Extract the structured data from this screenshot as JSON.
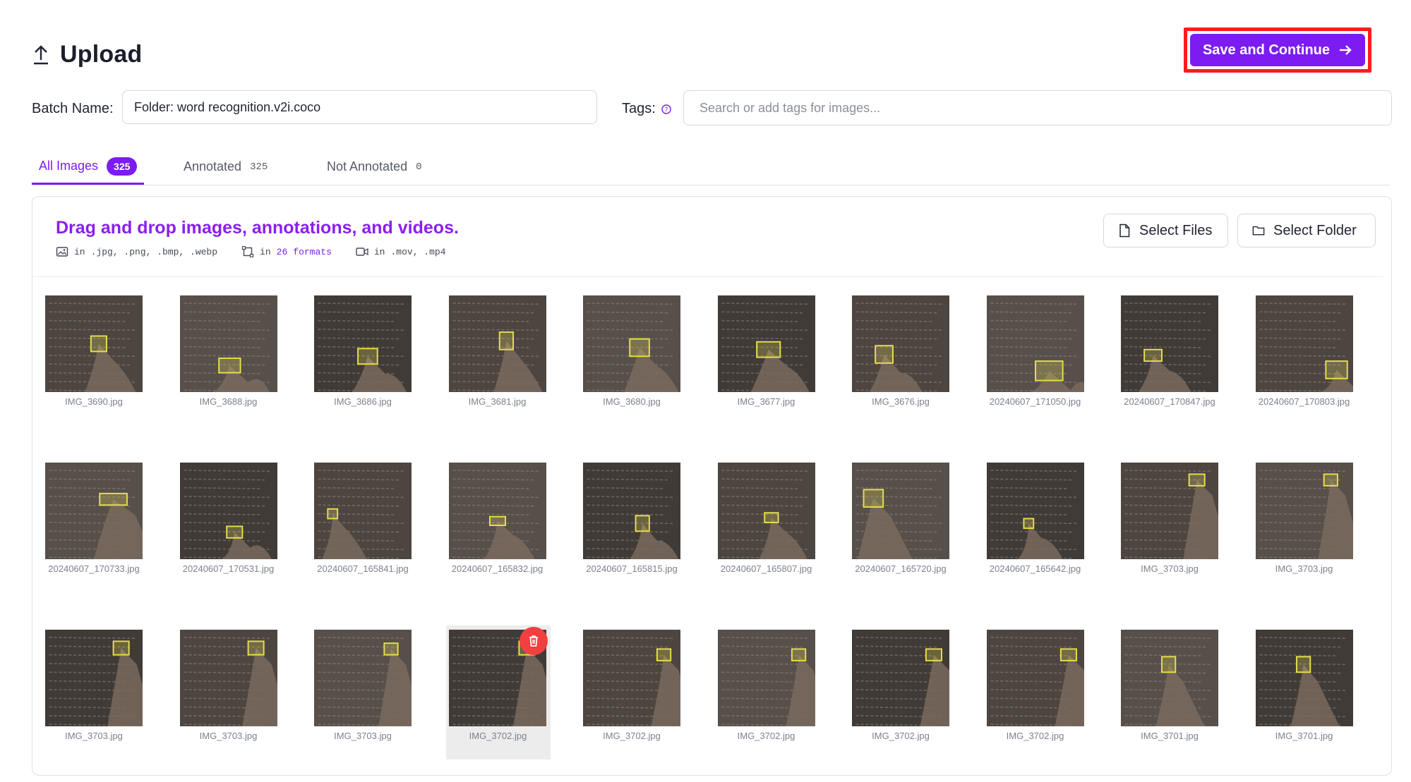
{
  "header": {
    "title": "Upload",
    "icon": "upload-icon"
  },
  "save_button": {
    "label": "Save and Continue",
    "icon": "arrow-right-icon",
    "color": "#7c1cf2"
  },
  "batch": {
    "label": "Batch Name:",
    "value": "Folder: word recognition.v2i.coco"
  },
  "tags": {
    "label": "Tags:",
    "placeholder": "Search or add tags for images..."
  },
  "tabs": [
    {
      "label": "All Images",
      "count": "325",
      "active": true
    },
    {
      "label": "Annotated",
      "count": "325",
      "active": false
    },
    {
      "label": "Not Annotated",
      "count": "0",
      "active": false
    }
  ],
  "dropzone": {
    "title": "Drag and drop images, annotations, and videos.",
    "formats": [
      {
        "icon": "image-icon",
        "prefix": "in",
        "text": ".jpg, .png, .bmp, .webp",
        "highlight": ""
      },
      {
        "icon": "bbox-icon",
        "prefix": "in",
        "text": "formats",
        "highlight": "26"
      },
      {
        "icon": "video-icon",
        "prefix": "in",
        "text": ".mov, .mp4",
        "highlight": ""
      }
    ],
    "select_files": "Select Files",
    "select_folder": "Select Folder"
  },
  "images": [
    [
      "IMG_3690.jpg",
      "IMG_3688.jpg",
      "IMG_3686.jpg",
      "IMG_3681.jpg",
      "IMG_3680.jpg",
      "IMG_3677.jpg",
      "IMG_3676.jpg",
      "20240607_171050.jpg",
      "20240607_170847.jpg",
      "20240607_170803.jpg"
    ],
    [
      "20240607_170733.jpg",
      "20240607_170531.jpg",
      "20240607_165841.jpg",
      "20240607_165832.jpg",
      "20240607_165815.jpg",
      "20240607_165807.jpg",
      "20240607_165720.jpg",
      "20240607_165642.jpg",
      "IMG_3703.jpg",
      "IMG_3703.jpg"
    ],
    [
      "IMG_3703.jpg",
      "IMG_3703.jpg",
      "IMG_3703.jpg",
      "IMG_3702.jpg",
      "IMG_3702.jpg",
      "IMG_3702.jpg",
      "IMG_3702.jpg",
      "IMG_3702.jpg",
      "IMG_3701.jpg",
      "IMG_3701.jpg"
    ]
  ],
  "hovered_thumb": {
    "row": 2,
    "col": 3,
    "action_icon": "trash-icon"
  }
}
